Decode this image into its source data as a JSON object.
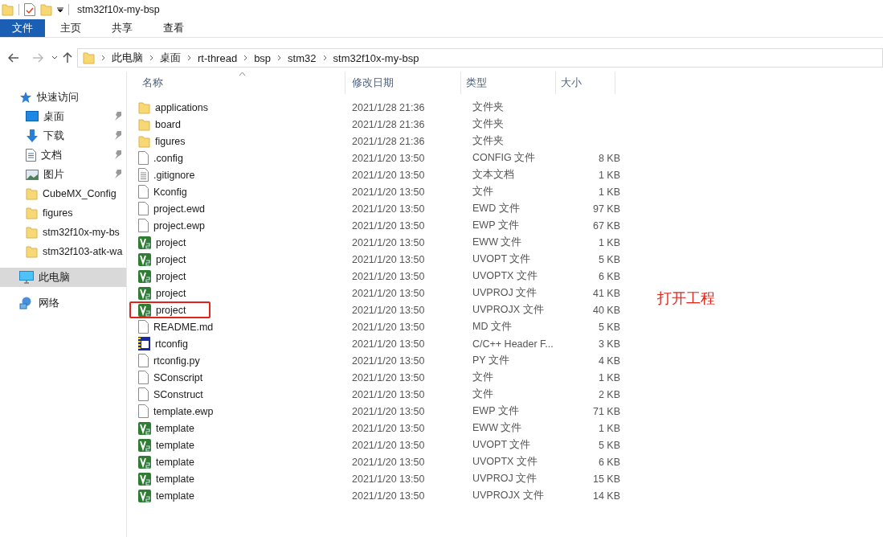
{
  "window": {
    "title": "stm32f10x-my-bsp"
  },
  "ribbon_tabs": [
    {
      "label": "文件",
      "selected": true
    },
    {
      "label": "主页",
      "selected": false
    },
    {
      "label": "共享",
      "selected": false
    },
    {
      "label": "查看",
      "selected": false
    }
  ],
  "address_bar": {
    "path": [
      "此电脑",
      "桌面",
      "rt-thread",
      "bsp",
      "stm32",
      "stm32f10x-my-bsp"
    ]
  },
  "sidebar": {
    "items": [
      {
        "label": "快速访问",
        "kind": "star",
        "pinned": false,
        "selected": false
      },
      {
        "label": "桌面",
        "kind": "desktop",
        "pinned": true,
        "selected": false
      },
      {
        "label": "下载",
        "kind": "download",
        "pinned": true,
        "selected": false
      },
      {
        "label": "文档",
        "kind": "document",
        "pinned": true,
        "selected": false
      },
      {
        "label": "图片",
        "kind": "picture",
        "pinned": true,
        "selected": false
      },
      {
        "label": "CubeMX_Config",
        "kind": "folder",
        "pinned": false,
        "selected": false
      },
      {
        "label": "figures",
        "kind": "folder",
        "pinned": false,
        "selected": false
      },
      {
        "label": "stm32f10x-my-bs",
        "kind": "folder",
        "pinned": false,
        "selected": false
      },
      {
        "label": "stm32f103-atk-wa",
        "kind": "folder",
        "pinned": false,
        "selected": false
      },
      {
        "label": "此电脑",
        "kind": "computer",
        "pinned": false,
        "selected": true
      },
      {
        "label": "网络",
        "kind": "network",
        "pinned": false,
        "selected": false
      }
    ]
  },
  "table": {
    "columns": [
      "名称",
      "修改日期",
      "类型",
      "大小"
    ],
    "rows": [
      {
        "name": "applications",
        "kind": "folder",
        "date": "2021/1/28 21:36",
        "type": "文件夹",
        "highlighted": false
      },
      {
        "name": "board",
        "kind": "folder",
        "date": "2021/1/28 21:36",
        "type": "文件夹",
        "highlighted": false
      },
      {
        "name": "figures",
        "kind": "folder",
        "date": "2021/1/28 21:36",
        "type": "文件夹",
        "highlighted": false
      },
      {
        "name": ".config",
        "kind": "file",
        "date": "2021/1/20 13:50",
        "type": "CONFIG 文件",
        "size": "8 KB",
        "highlighted": false
      },
      {
        "name": ".gitignore",
        "kind": "text",
        "date": "2021/1/20 13:50",
        "type": "文本文档",
        "size": "1 KB",
        "highlighted": false
      },
      {
        "name": "Kconfig",
        "kind": "file",
        "date": "2021/1/20 13:50",
        "type": "文件",
        "size": "1 KB",
        "highlighted": false
      },
      {
        "name": "project.ewd",
        "kind": "file",
        "date": "2021/1/20 13:50",
        "type": "EWD 文件",
        "size": "97 KB",
        "highlighted": false
      },
      {
        "name": "project.ewp",
        "kind": "file",
        "date": "2021/1/20 13:50",
        "type": "EWP 文件",
        "size": "67 KB",
        "highlighted": false
      },
      {
        "name": "project",
        "kind": "keil",
        "date": "2021/1/20 13:50",
        "type": "EWW 文件",
        "size": "1 KB",
        "highlighted": false
      },
      {
        "name": "project",
        "kind": "keil",
        "date": "2021/1/20 13:50",
        "type": "UVOPT 文件",
        "size": "5 KB",
        "highlighted": false
      },
      {
        "name": "project",
        "kind": "keil",
        "date": "2021/1/20 13:50",
        "type": "UVOPTX 文件",
        "size": "6 KB",
        "highlighted": false
      },
      {
        "name": "project",
        "kind": "keil",
        "date": "2021/1/20 13:50",
        "type": "UVPROJ 文件",
        "size": "41 KB",
        "highlighted": false
      },
      {
        "name": "project",
        "kind": "keil",
        "date": "2021/1/20 13:50",
        "type": "UVPROJX 文件",
        "size": "40 KB",
        "highlighted": true
      },
      {
        "name": "README.md",
        "kind": "file",
        "date": "2021/1/20 13:50",
        "type": "MD 文件",
        "size": "5 KB",
        "highlighted": false
      },
      {
        "name": "rtconfig",
        "kind": "header",
        "date": "2021/1/20 13:50",
        "type": "C/C++ Header F...",
        "size": "3 KB",
        "highlighted": false
      },
      {
        "name": "rtconfig.py",
        "kind": "file",
        "date": "2021/1/20 13:50",
        "type": "PY 文件",
        "size": "4 KB",
        "highlighted": false
      },
      {
        "name": "SConscript",
        "kind": "file",
        "date": "2021/1/20 13:50",
        "type": "文件",
        "size": "1 KB",
        "highlighted": false
      },
      {
        "name": "SConstruct",
        "kind": "file",
        "date": "2021/1/20 13:50",
        "type": "文件",
        "size": "2 KB",
        "highlighted": false
      },
      {
        "name": "template.ewp",
        "kind": "file",
        "date": "2021/1/20 13:50",
        "type": "EWP 文件",
        "size": "71 KB",
        "highlighted": false
      },
      {
        "name": "template",
        "kind": "keil",
        "date": "2021/1/20 13:50",
        "type": "EWW 文件",
        "size": "1 KB",
        "highlighted": false
      },
      {
        "name": "template",
        "kind": "keil",
        "date": "2021/1/20 13:50",
        "type": "UVOPT 文件",
        "size": "5 KB",
        "highlighted": false
      },
      {
        "name": "template",
        "kind": "keil",
        "date": "2021/1/20 13:50",
        "type": "UVOPTX 文件",
        "size": "6 KB",
        "highlighted": false
      },
      {
        "name": "template",
        "kind": "keil",
        "date": "2021/1/20 13:50",
        "type": "UVPROJ 文件",
        "size": "15 KB",
        "highlighted": false
      },
      {
        "name": "template",
        "kind": "keil",
        "date": "2021/1/20 13:50",
        "type": "UVPROJX 文件",
        "size": "14 KB",
        "highlighted": false
      }
    ]
  },
  "annotation": "打开工程"
}
